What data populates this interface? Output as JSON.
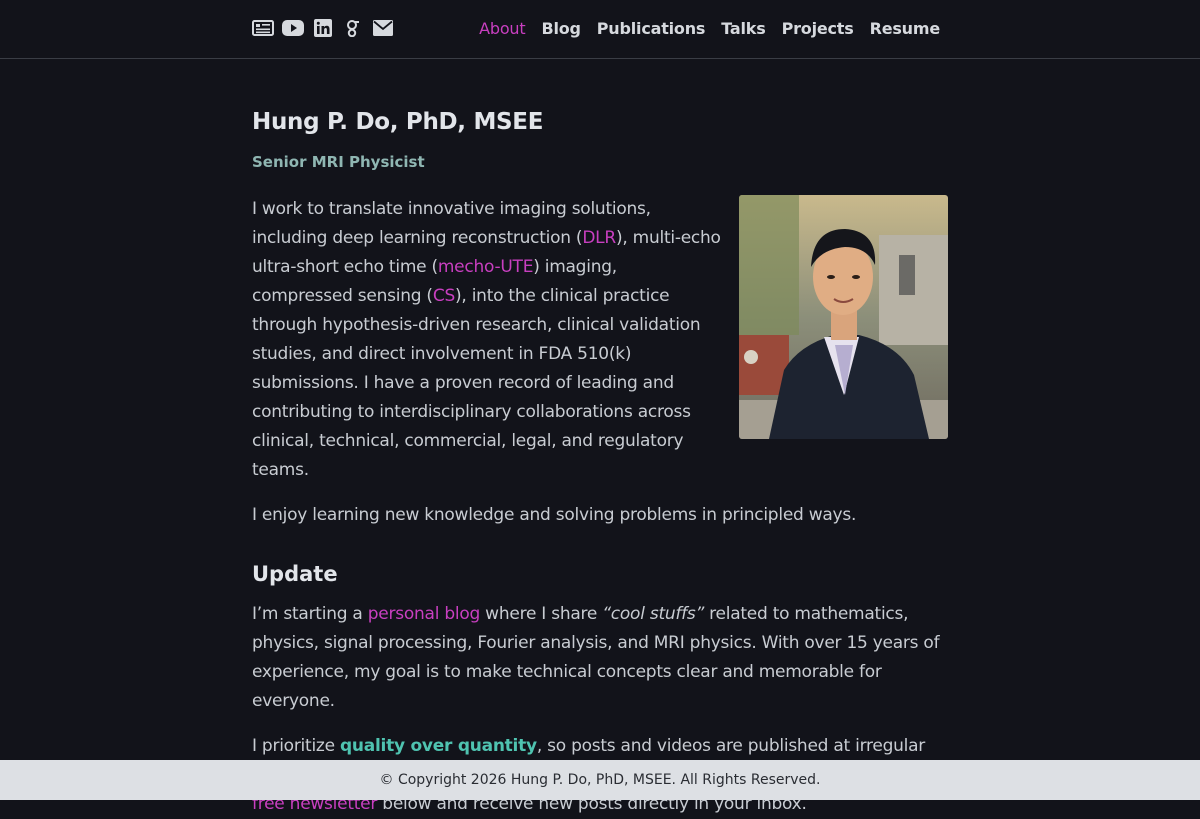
{
  "nav": {
    "social_icons": [
      "rss-icon",
      "youtube-icon",
      "linkedin-icon",
      "google-scholar-icon",
      "email-icon"
    ],
    "links": [
      {
        "label": "About",
        "active": true
      },
      {
        "label": "Blog"
      },
      {
        "label": "Publications"
      },
      {
        "label": "Talks"
      },
      {
        "label": "Projects"
      },
      {
        "label": "Resume"
      }
    ]
  },
  "profile": {
    "name": "Hung P. Do, PhD, MSEE",
    "title": "Senior MRI Physicist"
  },
  "intro": {
    "t1": "I work to translate innovative imaging solutions, including deep learning reconstruction (",
    "l1": "DLR",
    "t2": "), multi-echo ultra-short echo time (",
    "l2": "mecho-UTE",
    "t3": ") imaging, compressed sensing (",
    "l3": "CS",
    "t4": "), into the clinical practice through hypothesis-driven research, clinical validation studies, and direct involvement in FDA 510(k) submissions. I have a proven record of leading and contributing to interdisciplinary collaborations across clinical, technical, commercial, legal, and regulatory teams."
  },
  "enjoy": "I enjoy learning new knowledge and solving problems in principled ways.",
  "update": {
    "heading": "Update",
    "p1_a": "I’m starting a ",
    "p1_link": "personal blog",
    "p1_b": " where I share ",
    "p1_em": "“cool stuffs”",
    "p1_c": " related to mathematics, physics, signal processing, Fourier analysis, and MRI physics. With over 15 years of experience, my goal is to make technical concepts clear and memorable for everyone.",
    "p2_a": "I prioritize ",
    "p2_hl": "quality over quantity",
    "p2_b": ", so posts and videos are published at irregular intervals. The best way to stay informed about future posts is to subscribe to the ",
    "p2_link": "free newsletter",
    "p2_c": " below and receive new posts directly in your inbox."
  },
  "footer": "© Copyright 2026 Hung P. Do, PhD, MSEE. All Rights Reserved.",
  "colors": {
    "background": "#12131a",
    "link": "#c83fc0",
    "accent_teal": "#4fc3b0",
    "subtitle": "#8fb6b2",
    "footer_bg": "#dde0e4"
  }
}
